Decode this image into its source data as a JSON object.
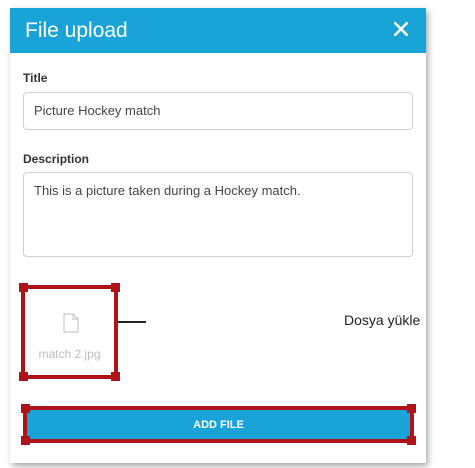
{
  "dialog": {
    "title": "File upload",
    "close_icon": "close-icon",
    "title_field": {
      "label": "Title",
      "value": "Picture Hockey match"
    },
    "description_field": {
      "label": "Description",
      "value": "This is a picture taken during a Hockey match."
    },
    "attached_file": {
      "icon": "file-icon",
      "name": "match 2.jpg"
    },
    "add_file_label": "ADD FILE"
  },
  "annotation": {
    "callout_text": "Dosya yükle"
  },
  "colors": {
    "header": "#1aa3d6",
    "button": "#1aa3d6",
    "highlight": "#b0121a"
  }
}
